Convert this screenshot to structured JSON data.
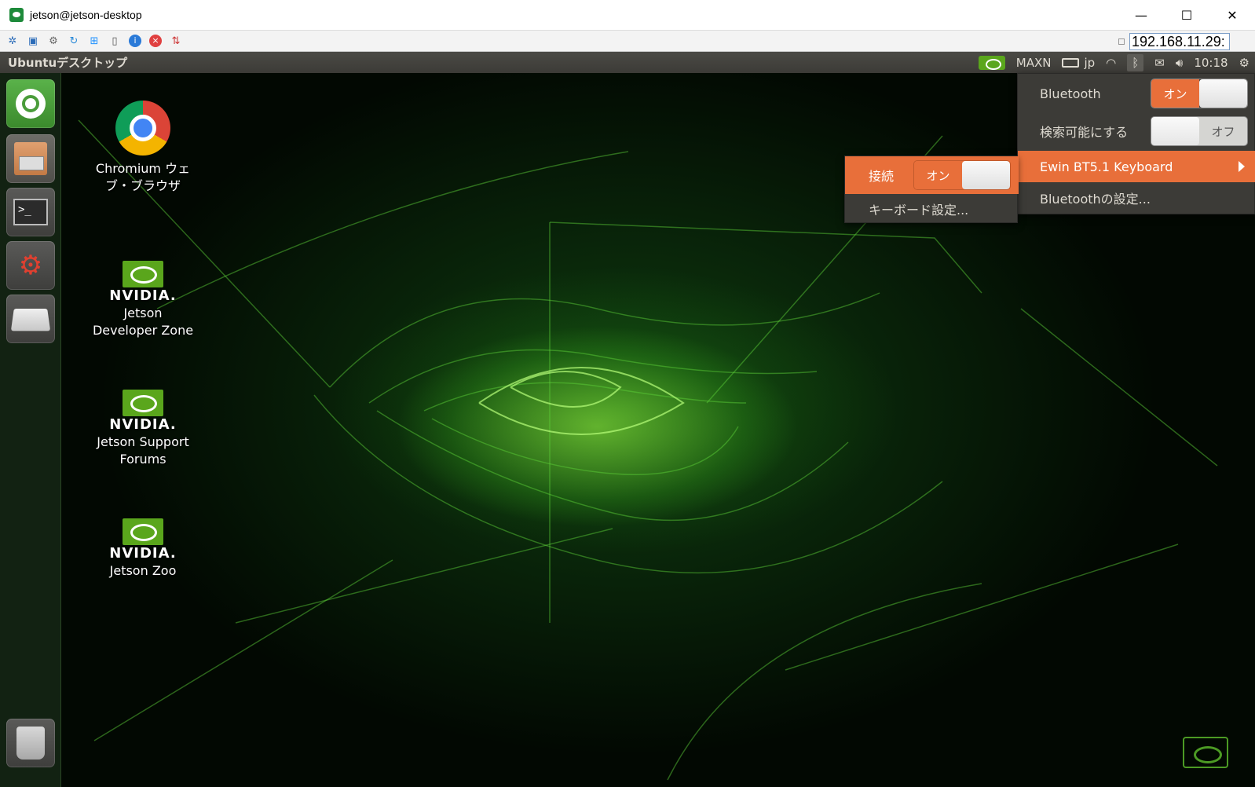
{
  "window": {
    "title": "jetson@jetson-desktop",
    "minimize": "—",
    "maximize": "☐",
    "close": "✕"
  },
  "vnc_toolbar": {
    "address": "192.168.11.29:",
    "buttons": [
      "options-icon",
      "fullscreen-icon",
      "settings-icon",
      "refresh-icon",
      "windows-key-icon",
      "ctrl-alt-del-icon",
      "info-icon",
      "disconnect-icon",
      "transfer-icon"
    ]
  },
  "top_panel": {
    "title": "Ubuntuデスクトップ",
    "power_mode": "MAXN",
    "keyboard_layout": "jp",
    "clock": "10:18"
  },
  "launcher": {
    "items": [
      "ubuntu-dash",
      "files",
      "terminal",
      "system-settings",
      "removable-drive",
      "trash"
    ]
  },
  "desktop_icons": {
    "chromium": {
      "label_line1": "Chromium ウェ",
      "label_line2": "ブ・ブラウザ"
    },
    "dev_zone": {
      "brand": "NVIDIA.",
      "line1": "Jetson",
      "line2": "Developer Zone"
    },
    "forums": {
      "brand": "NVIDIA.",
      "line1": "Jetson Support",
      "line2": "Forums"
    },
    "zoo": {
      "brand": "NVIDIA.",
      "line1": "Jetson Zoo"
    }
  },
  "bluetooth_menu": {
    "bluetooth_label": "Bluetooth",
    "bluetooth_toggle": "オン",
    "discoverable_label": "検索可能にする",
    "discoverable_toggle": "オフ",
    "device_label": "Ewin BT5.1 Keyboard",
    "settings_label": "Bluetoothの設定..."
  },
  "device_submenu": {
    "connect_label": "接続",
    "connect_toggle": "オン",
    "keyboard_settings": "キーボード設定..."
  },
  "colors": {
    "accent_orange": "#e86f3a",
    "panel_bg": "#3c3b37",
    "nvidia_green": "#76b900"
  }
}
